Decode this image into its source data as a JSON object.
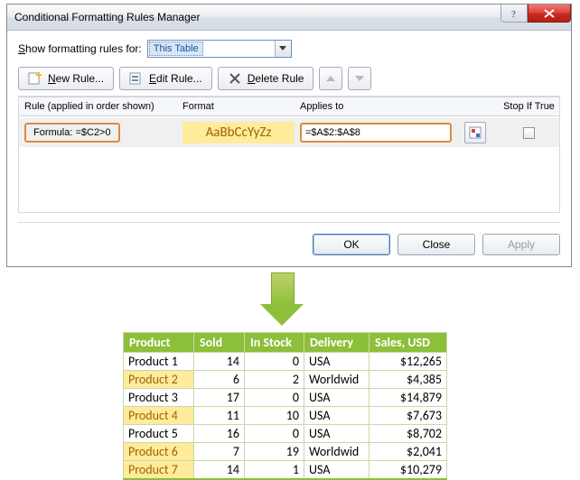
{
  "dialog": {
    "title": "Conditional Formatting Rules Manager",
    "show_label_pre": "S",
    "show_label_post": "how formatting rules for:",
    "scope_value": "This Table",
    "toolbar": {
      "new_pre": "N",
      "new_post": "ew Rule...",
      "edit_pre": "E",
      "edit_post": "dit Rule...",
      "delete_pre": "D",
      "delete_post": "elete Rule"
    },
    "headers": {
      "rule": "Rule (applied in order shown)",
      "format": "Format",
      "applies": "Applies to",
      "stop": "Stop If True"
    },
    "rule": {
      "name": "Formula: =$C2>0",
      "format_sample": "AaBbCcYyZz",
      "applies_to": "=$A$2:$A$8"
    },
    "footer": {
      "ok": "OK",
      "close": "Close",
      "apply": "Apply"
    }
  },
  "table": {
    "headers": [
      "Product",
      "Sold",
      "In Stock",
      "Delivery",
      "Sales,  USD"
    ],
    "rows": [
      {
        "product": "Product 1",
        "sold": "14",
        "stock": "0",
        "delivery": "USA",
        "sales": "$12,265",
        "hl": false
      },
      {
        "product": "Product 2",
        "sold": "6",
        "stock": "2",
        "delivery": "Worldwid",
        "sales": "$4,385",
        "hl": true
      },
      {
        "product": "Product 3",
        "sold": "17",
        "stock": "0",
        "delivery": "USA",
        "sales": "$14,879",
        "hl": false
      },
      {
        "product": "Product 4",
        "sold": "11",
        "stock": "10",
        "delivery": "USA",
        "sales": "$7,673",
        "hl": true
      },
      {
        "product": "Product 5",
        "sold": "16",
        "stock": "0",
        "delivery": "USA",
        "sales": "$8,702",
        "hl": false
      },
      {
        "product": "Product 6",
        "sold": "7",
        "stock": "19",
        "delivery": "Worldwid",
        "sales": "$2,041",
        "hl": true
      },
      {
        "product": "Product 7",
        "sold": "14",
        "stock": "1",
        "delivery": "USA",
        "sales": "$10,279",
        "hl": true
      }
    ]
  }
}
